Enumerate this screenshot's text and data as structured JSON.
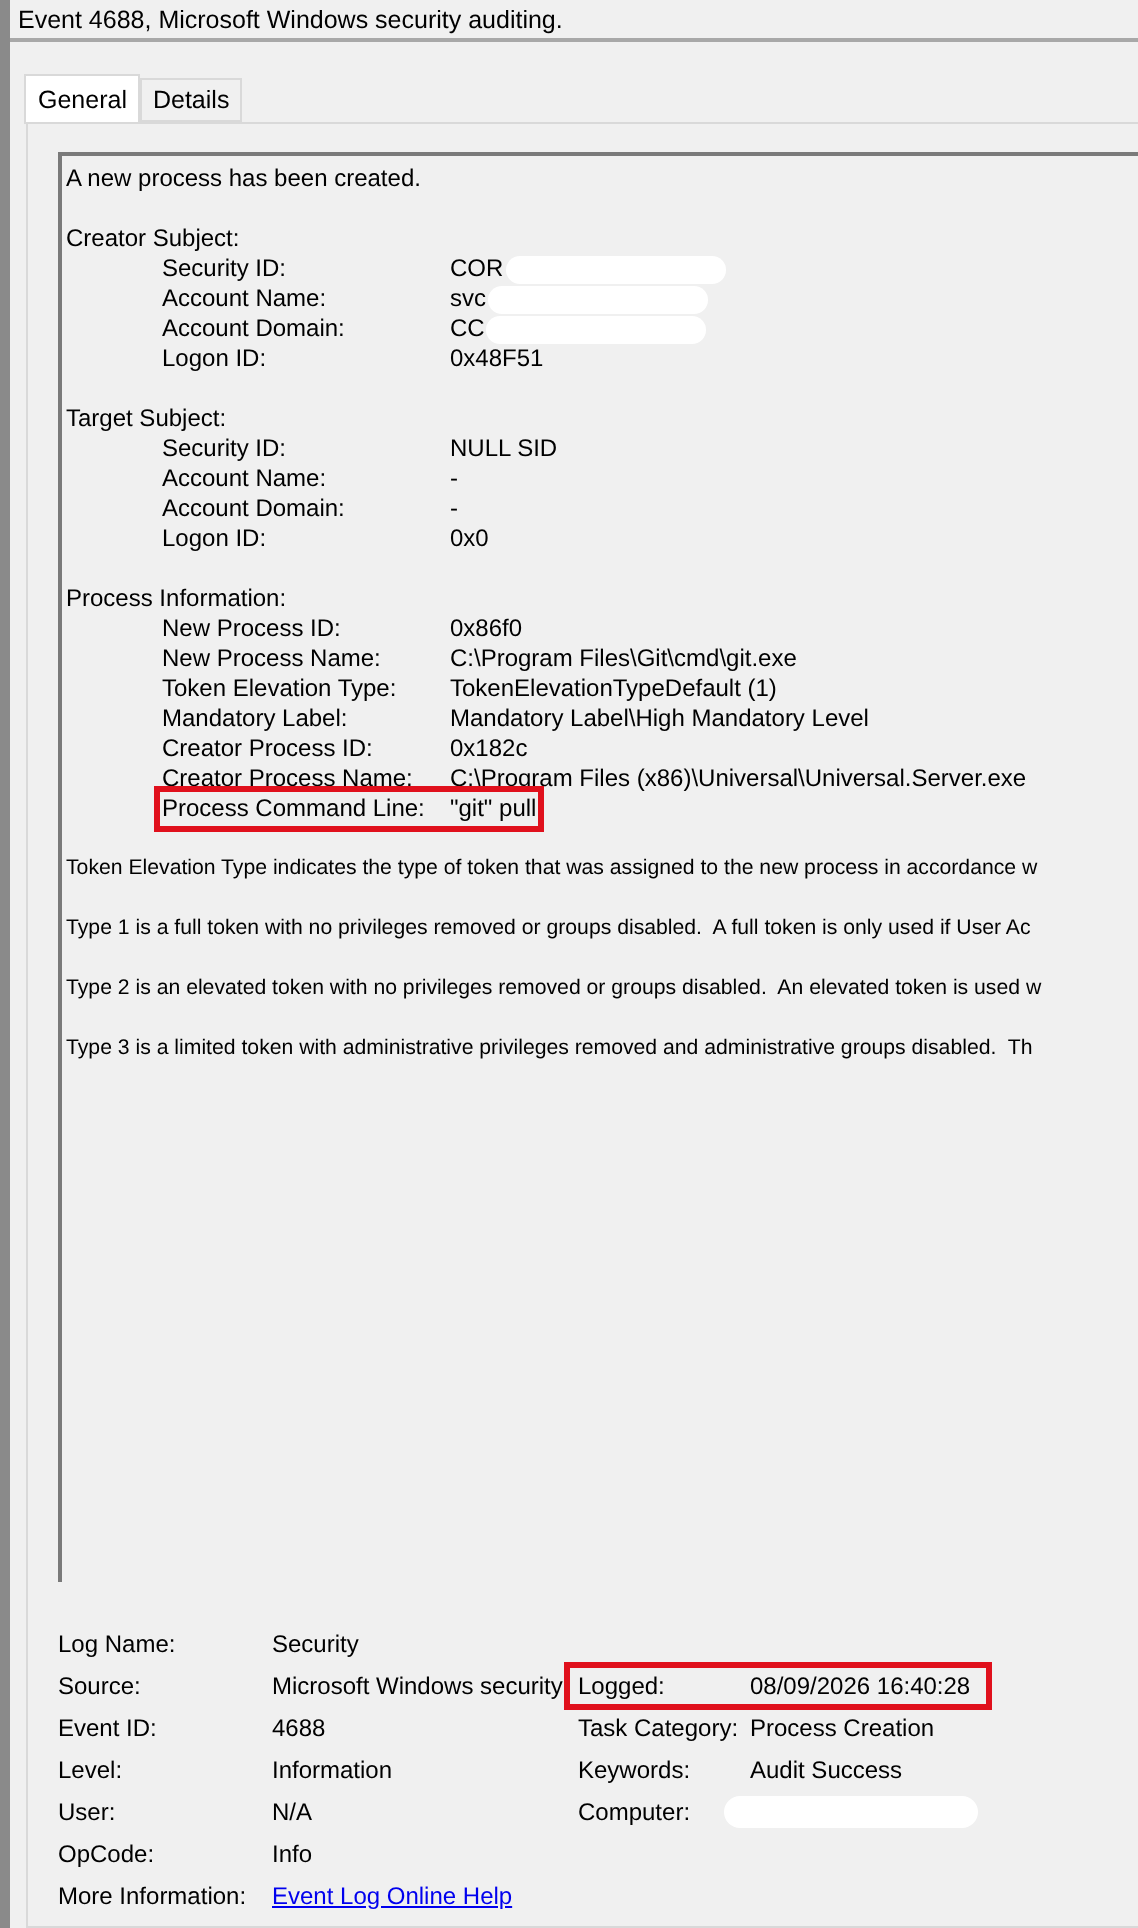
{
  "window": {
    "title": "Event 4688, Microsoft Windows security auditing."
  },
  "tabs": [
    {
      "label": "General",
      "selected": true
    },
    {
      "label": "Details",
      "selected": false
    }
  ],
  "description": {
    "intro": "A new process has been created.",
    "sections": [
      {
        "heading": "Creator Subject:",
        "fields": [
          {
            "label": "Security ID:",
            "value": "COR",
            "redacted": true,
            "highlighted": false
          },
          {
            "label": "Account Name:",
            "value": "svc",
            "redacted": true,
            "highlighted": false
          },
          {
            "label": "Account Domain:",
            "value": "CC",
            "redacted": true,
            "highlighted": false
          },
          {
            "label": "Logon ID:",
            "value": "0x48F51",
            "redacted": false,
            "highlighted": false
          }
        ]
      },
      {
        "heading": "Target Subject:",
        "fields": [
          {
            "label": "Security ID:",
            "value": "NULL SID",
            "redacted": false,
            "highlighted": false
          },
          {
            "label": "Account Name:",
            "value": "-",
            "redacted": false,
            "highlighted": false
          },
          {
            "label": "Account Domain:",
            "value": "-",
            "redacted": false,
            "highlighted": false
          },
          {
            "label": "Logon ID:",
            "value": "0x0",
            "redacted": false,
            "highlighted": false
          }
        ]
      },
      {
        "heading": "Process Information:",
        "fields": [
          {
            "label": "New Process ID:",
            "value": "0x86f0",
            "redacted": false,
            "highlighted": false
          },
          {
            "label": "New Process Name:",
            "value": "C:\\Program Files\\Git\\cmd\\git.exe",
            "redacted": false,
            "highlighted": false
          },
          {
            "label": "Token Elevation Type:",
            "value": "TokenElevationTypeDefault (1)",
            "redacted": false,
            "highlighted": false
          },
          {
            "label": "Mandatory Label:",
            "value": "Mandatory Label\\High Mandatory Level",
            "redacted": false,
            "highlighted": false
          },
          {
            "label": "Creator Process ID:",
            "value": "0x182c",
            "redacted": false,
            "highlighted": false
          },
          {
            "label": "Creator Process Name:",
            "value": "C:\\Program Files (x86)\\Universal\\Universal.Server.exe",
            "redacted": false,
            "highlighted": false
          },
          {
            "label": "Process Command Line:",
            "value": "\"git\" pull",
            "redacted": false,
            "highlighted": true
          }
        ]
      }
    ],
    "paragraphs": [
      "Token Elevation Type indicates the type of token that was assigned to the new process in accordance w",
      "Type 1 is a full token with no privileges removed or groups disabled.  A full token is only used if User Ac",
      "Type 2 is an elevated token with no privileges removed or groups disabled.  An elevated token is used w",
      "Type 3 is a limited token with administrative privileges removed and administrative groups disabled.  Th"
    ]
  },
  "properties": [
    {
      "left": {
        "label": "Log Name:",
        "value": "Security",
        "kind": "text"
      }
    },
    {
      "left": {
        "label": "Source:",
        "value": "Microsoft Windows security",
        "kind": "text"
      },
      "right": {
        "label": "Logged:",
        "value": "08/09/2026 16:40:28",
        "highlighted": true
      }
    },
    {
      "left": {
        "label": "Event ID:",
        "value": "4688",
        "kind": "text"
      },
      "right": {
        "label": "Task Category:",
        "value": "Process Creation",
        "highlighted": false
      }
    },
    {
      "left": {
        "label": "Level:",
        "value": "Information",
        "kind": "text"
      },
      "right": {
        "label": "Keywords:",
        "value": "Audit Success",
        "highlighted": false
      }
    },
    {
      "left": {
        "label": "User:",
        "value": "N/A",
        "kind": "text"
      },
      "right": {
        "label": "Computer:",
        "redacted": true,
        "highlighted": false
      }
    },
    {
      "left": {
        "label": "OpCode:",
        "value": "Info",
        "kind": "text"
      }
    },
    {
      "left": {
        "label": "More Information:",
        "value": "Event Log Online Help",
        "kind": "link"
      }
    }
  ]
}
